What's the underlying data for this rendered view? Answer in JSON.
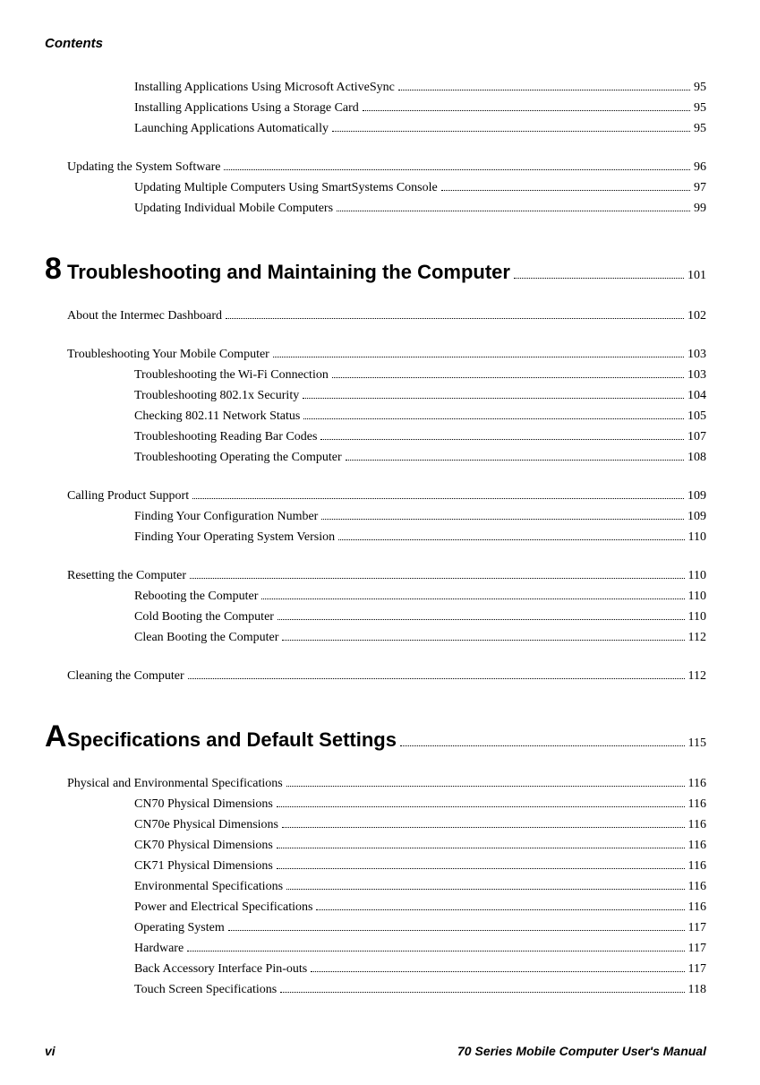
{
  "header": "Contents",
  "top_items": [
    {
      "indent": 1,
      "text": "Installing Applications Using Microsoft ActiveSync",
      "page": "95"
    },
    {
      "indent": 1,
      "text": "Installing Applications Using a Storage Card",
      "page": "95"
    },
    {
      "indent": 1,
      "text": "Launching Applications Automatically",
      "page": "95"
    }
  ],
  "section_updating": [
    {
      "indent": 2,
      "text": "Updating the System Software",
      "page": "96"
    },
    {
      "indent": 1,
      "text": "Updating Multiple Computers Using SmartSystems Console",
      "page": "97"
    },
    {
      "indent": 1,
      "text": "Updating Individual Mobile Computers",
      "page": "99"
    }
  ],
  "chapter8": {
    "num": "8",
    "title": "Troubleshooting and Maintaining the Computer",
    "page": "101"
  },
  "ch8_items_a": [
    {
      "indent": 2,
      "text": "About the Intermec Dashboard",
      "page": "102"
    }
  ],
  "ch8_items_b": [
    {
      "indent": 2,
      "text": "Troubleshooting Your Mobile Computer",
      "page": "103"
    },
    {
      "indent": 1,
      "text": "Troubleshooting the Wi-Fi Connection",
      "page": "103"
    },
    {
      "indent": 1,
      "text": "Troubleshooting 802.1x Security",
      "page": "104"
    },
    {
      "indent": 1,
      "text": "Checking 802.11 Network Status",
      "page": "105"
    },
    {
      "indent": 1,
      "text": "Troubleshooting Reading Bar Codes",
      "page": "107"
    },
    {
      "indent": 1,
      "text": "Troubleshooting Operating the Computer",
      "page": "108"
    }
  ],
  "ch8_items_c": [
    {
      "indent": 2,
      "text": "Calling Product Support",
      "page": "109"
    },
    {
      "indent": 1,
      "text": "Finding Your Configuration Number",
      "page": "109"
    },
    {
      "indent": 1,
      "text": "Finding Your Operating System Version",
      "page": "110"
    }
  ],
  "ch8_items_d": [
    {
      "indent": 2,
      "text": "Resetting the Computer",
      "page": "110"
    },
    {
      "indent": 1,
      "text": "Rebooting the Computer",
      "page": "110"
    },
    {
      "indent": 1,
      "text": "Cold Booting the Computer",
      "page": "110"
    },
    {
      "indent": 1,
      "text": "Clean Booting the Computer",
      "page": "112"
    }
  ],
  "ch8_items_e": [
    {
      "indent": 2,
      "text": "Cleaning the Computer",
      "page": "112"
    }
  ],
  "chapterA": {
    "num": "A",
    "title": "Specifications and Default Settings",
    "page": "115"
  },
  "chA_items": [
    {
      "indent": 2,
      "text": "Physical and Environmental Specifications",
      "page": "116"
    },
    {
      "indent": 1,
      "text": "CN70 Physical Dimensions",
      "page": "116"
    },
    {
      "indent": 1,
      "text": "CN70e Physical Dimensions",
      "page": "116"
    },
    {
      "indent": 1,
      "text": "CK70 Physical Dimensions",
      "page": "116"
    },
    {
      "indent": 1,
      "text": "CK71 Physical Dimensions",
      "page": "116"
    },
    {
      "indent": 1,
      "text": "Environmental Specifications",
      "page": "116"
    },
    {
      "indent": 1,
      "text": "Power and Electrical Specifications",
      "page": "116"
    },
    {
      "indent": 1,
      "text": "Operating System",
      "page": "117"
    },
    {
      "indent": 1,
      "text": "Hardware",
      "page": "117"
    },
    {
      "indent": 1,
      "text": "Back Accessory Interface Pin-outs",
      "page": "117"
    },
    {
      "indent": 1,
      "text": "Touch Screen Specifications",
      "page": "118"
    }
  ],
  "footer_left": "vi",
  "footer_right": "70 Series Mobile Computer User's Manual"
}
